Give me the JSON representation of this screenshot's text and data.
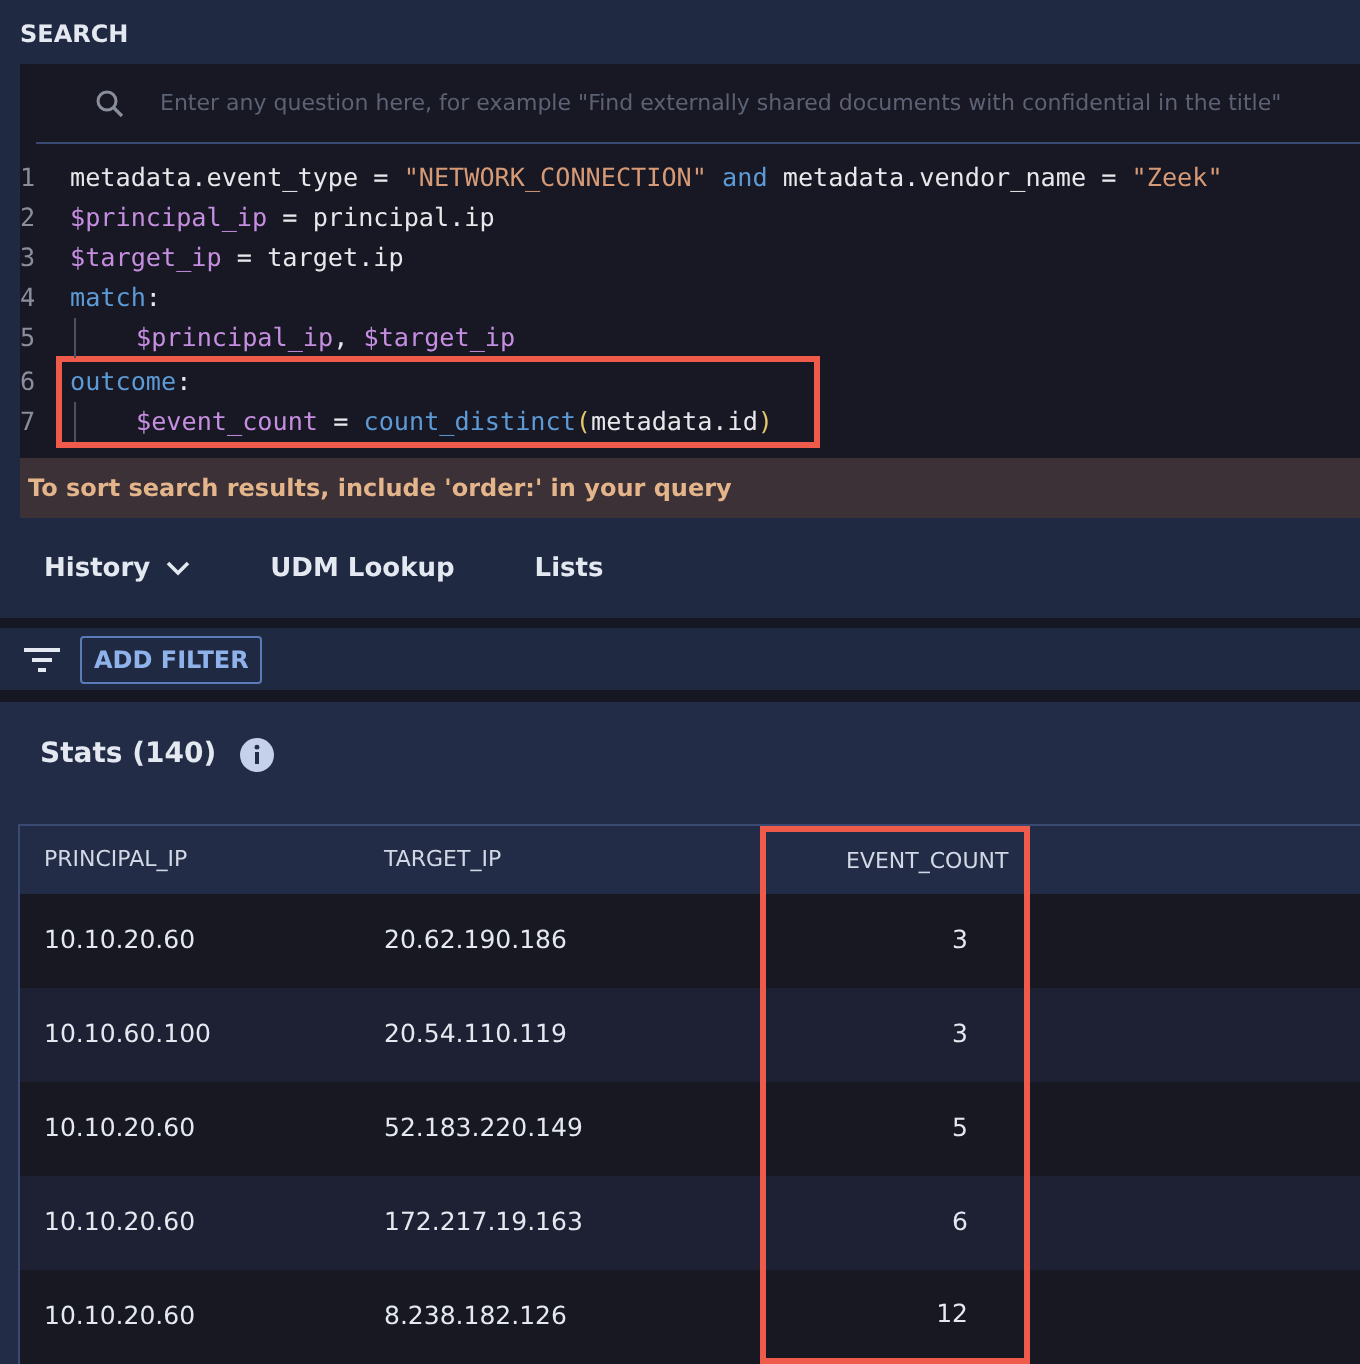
{
  "panel": {
    "title": "SEARCH"
  },
  "search": {
    "placeholder": "Enter any question here, for example \"Find externally shared documents with confidential in the title\""
  },
  "code_lines": [
    {
      "number": "1",
      "indented": false,
      "highlighted": false,
      "tokens": [
        {
          "kind": "plain",
          "text": "metadata.event_type = "
        },
        {
          "kind": "string",
          "text": "\"NETWORK_CONNECTION\""
        },
        {
          "kind": "keyword",
          "text": " and "
        },
        {
          "kind": "plain",
          "text": "metadata.vendor_name = "
        },
        {
          "kind": "string",
          "text": "\"Zeek\""
        }
      ]
    },
    {
      "number": "2",
      "indented": false,
      "highlighted": false,
      "tokens": [
        {
          "kind": "variable",
          "text": "$principal_ip"
        },
        {
          "kind": "plain",
          "text": " = principal.ip"
        }
      ]
    },
    {
      "number": "3",
      "indented": false,
      "highlighted": false,
      "tokens": [
        {
          "kind": "variable",
          "text": "$target_ip"
        },
        {
          "kind": "plain",
          "text": " = target.ip"
        }
      ]
    },
    {
      "number": "4",
      "indented": false,
      "highlighted": false,
      "tokens": [
        {
          "kind": "keyword",
          "text": "match"
        },
        {
          "kind": "plain",
          "text": ":"
        }
      ]
    },
    {
      "number": "5",
      "indented": true,
      "highlighted": false,
      "tokens": [
        {
          "kind": "variable",
          "text": "$principal_ip"
        },
        {
          "kind": "plain",
          "text": ", "
        },
        {
          "kind": "variable",
          "text": "$target_ip"
        }
      ]
    },
    {
      "number": "6",
      "indented": false,
      "highlighted": true,
      "tokens": [
        {
          "kind": "keyword",
          "text": "outcome"
        },
        {
          "kind": "plain",
          "text": ":"
        }
      ]
    },
    {
      "number": "7",
      "indented": true,
      "highlighted": true,
      "tokens": [
        {
          "kind": "variable",
          "text": "$event_count"
        },
        {
          "kind": "plain",
          "text": " = "
        },
        {
          "kind": "function",
          "text": "count_distinct"
        },
        {
          "kind": "paren",
          "text": "("
        },
        {
          "kind": "plain",
          "text": "metadata.id"
        },
        {
          "kind": "paren",
          "text": ")"
        }
      ]
    }
  ],
  "hint": "To sort search results, include 'order:' in your query",
  "tabs": [
    {
      "label": "History",
      "dropdown": true
    },
    {
      "label": "UDM Lookup",
      "dropdown": false
    },
    {
      "label": "Lists",
      "dropdown": false
    }
  ],
  "filter_button": "ADD FILTER",
  "stats_title": "Stats (140)",
  "table": {
    "columns": [
      {
        "label": "PRINCIPAL_IP",
        "right_aligned": false,
        "highlighted": false
      },
      {
        "label": "TARGET_IP",
        "right_aligned": false,
        "highlighted": false
      },
      {
        "label": "EVENT_COUNT",
        "right_aligned": true,
        "highlighted": true
      }
    ],
    "rows": [
      [
        "10.10.20.60",
        "20.62.190.186",
        "3"
      ],
      [
        "10.10.60.100",
        "20.54.110.119",
        "3"
      ],
      [
        "10.10.20.60",
        "52.183.220.149",
        "5"
      ],
      [
        "10.10.20.60",
        "172.217.19.163",
        "6"
      ],
      [
        "10.10.20.60",
        "8.238.182.126",
        "12"
      ]
    ]
  }
}
